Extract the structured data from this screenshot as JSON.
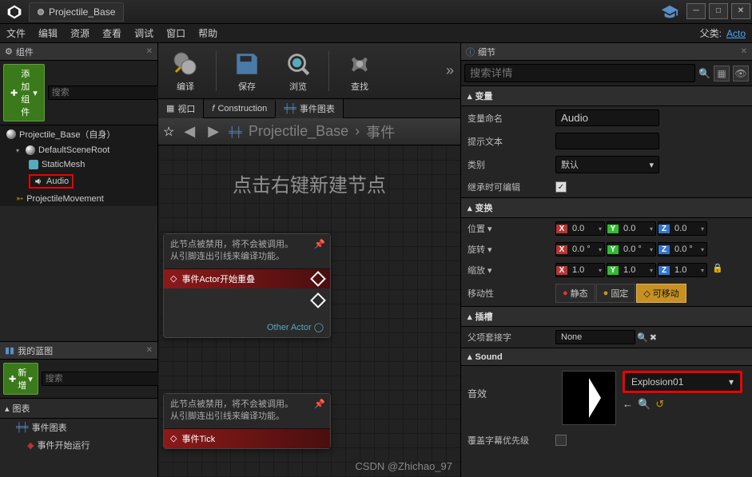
{
  "title": "Projectile_Base",
  "menubar": [
    "文件",
    "编辑",
    "资源",
    "查看",
    "调试",
    "窗口",
    "帮助"
  ],
  "parent_class_label": "父类:",
  "parent_class_value": "Acto",
  "components": {
    "panel_title": "组件",
    "add_label": "添加组件",
    "search_placeholder": "搜索",
    "items": {
      "root": "Projectile_Base（自身）",
      "scene_root": "DefaultSceneRoot",
      "static_mesh": "StaticMesh",
      "audio": "Audio",
      "proj_move": "ProjectileMovement"
    }
  },
  "blueprints": {
    "panel_title": "我的蓝图",
    "new_label": "新增",
    "search_placeholder": "搜索",
    "graph_section": "图表",
    "event_graph": "事件图表",
    "begin_play": "事件开始运行"
  },
  "toolbar": {
    "compile": "编译",
    "save": "保存",
    "browse": "浏览",
    "find": "查找"
  },
  "tabs": {
    "viewport": "视口",
    "construction": "Construction",
    "event_graph": "事件图表"
  },
  "pathbar": {
    "crumb1": "Projectile_Base",
    "crumb2": "事件"
  },
  "canvas": {
    "tip": "点击右键新建节点",
    "hint": "此节点被禁用，将不会被调用。\n从引脚连出引线来编译功能。",
    "node1_title": "事件Actor开始重叠",
    "node1_other": "Other Actor",
    "node2_title": "事件Tick"
  },
  "details": {
    "panel_title": "细节",
    "search_placeholder": "搜索详情",
    "var_section": "变量",
    "var_name_label": "变量命名",
    "var_name_value": "Audio",
    "tooltip_label": "提示文本",
    "tooltip_value": "",
    "category_label": "类别",
    "category_value": "默认",
    "editable_label": "继承时可编辑",
    "transform_section": "变换",
    "pos_label": "位置",
    "rot_label": "旋转",
    "scale_label": "缩放",
    "pos": {
      "x": "0.0",
      "y": "0.0",
      "z": "0.0"
    },
    "rot": {
      "x": "0.0 °",
      "y": "0.0 °",
      "z": "0.0 °"
    },
    "scale": {
      "x": "1.0",
      "y": "1.0",
      "z": "1.0"
    },
    "mobility_label": "移动性",
    "mob_static": "静态",
    "mob_stationary": "固定",
    "mob_movable": "可移动",
    "slot_section": "插槽",
    "slot_label": "父项套接字",
    "slot_value": "None",
    "sound_section": "Sound",
    "sound_label": "音效",
    "sound_value": "Explosion01",
    "subtitle_label": "覆盖字幕优先级"
  },
  "watermark": "CSDN @Zhichao_97"
}
